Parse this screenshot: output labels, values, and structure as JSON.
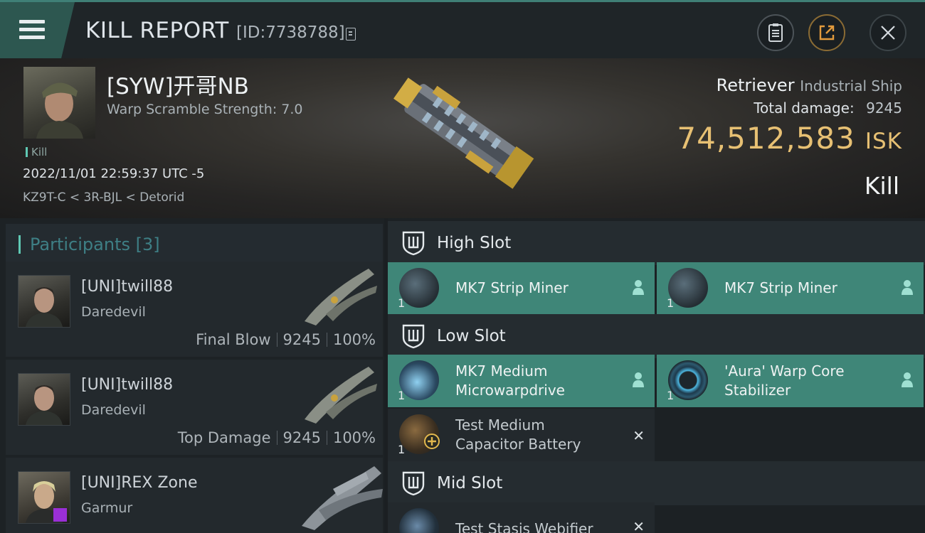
{
  "header": {
    "title": "KILL REPORT",
    "id_label": "[ID:7738788]"
  },
  "victim": {
    "pilot": "[SYW]开哥NB",
    "warp_scramble": "Warp Scramble Strength: 7.0",
    "tag": "Kill",
    "datetime": "2022/11/01 22:59:37 UTC -5",
    "location": "KZ9T-C < 3R-BJL < Detorid",
    "ship": "Retriever",
    "ship_class": "Industrial Ship",
    "total_damage_label": "Total damage:",
    "total_damage": "9245",
    "isk_value": "74,512,583",
    "isk_unit": "ISK",
    "result": "Kill"
  },
  "participants": {
    "label": "Participants",
    "count": "[3]",
    "rows": [
      {
        "name": "[UNI]twill88",
        "ship": "Daredevil",
        "role": "Final Blow",
        "damage": "9245",
        "percent": "100%"
      },
      {
        "name": "[UNI]twill88",
        "ship": "Daredevil",
        "role": "Top Damage",
        "damage": "9245",
        "percent": "100%"
      },
      {
        "name": "[UNI]REX Zone",
        "ship": "Garmur",
        "role": "",
        "damage": "",
        "percent": ""
      }
    ]
  },
  "slots": {
    "high": {
      "label": "High Slot",
      "modules": [
        {
          "name": "MK7 Strip Miner",
          "qty": "1"
        },
        {
          "name": "MK7 Strip Miner",
          "qty": "1"
        }
      ]
    },
    "low": {
      "label": "Low Slot",
      "modules": [
        {
          "name_line1": "MK7 Medium",
          "name_line2": "Microwarpdrive",
          "qty": "1"
        },
        {
          "name_line1": "'Aura' Warp Core",
          "name_line2": "Stabilizer",
          "qty": "1"
        },
        {
          "name_line1": "Test Medium",
          "name_line2": "Capacitor Battery",
          "qty": "1"
        }
      ]
    },
    "mid": {
      "label": "Mid Slot",
      "modules": [
        {
          "name": "Test Stasis Webifier"
        }
      ]
    }
  },
  "colors": {
    "accent": "#3f8678",
    "isk": "#e7c073",
    "teal_text": "#5fc9b4"
  }
}
